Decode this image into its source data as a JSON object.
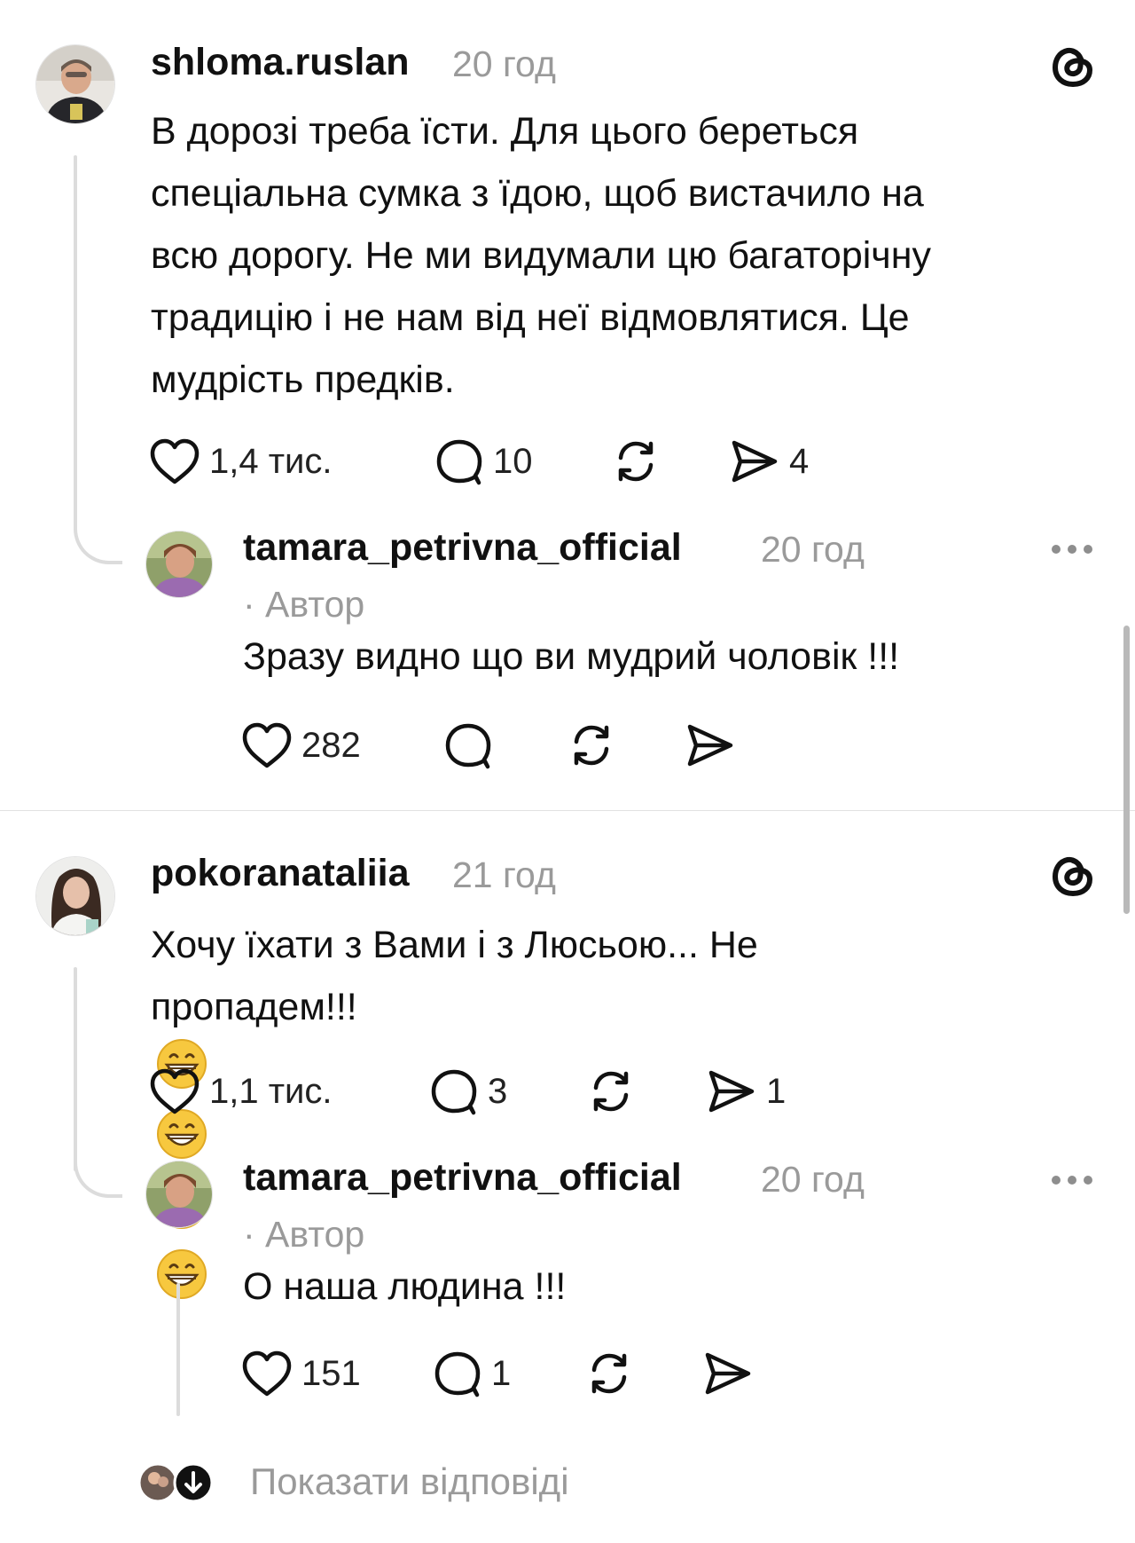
{
  "posts": [
    {
      "username": "shloma.ruslan",
      "time": "20 год",
      "text_lines": [
        "В дорозі треба їсти. Для цього береться",
        "спеціальна сумка з їдою, щоб вистачило на",
        "всю дорогу. Не ми видумали цю багаторічну",
        "традицію і не нам від неї відмовлятися. Це",
        "мудрість предків."
      ],
      "likes": "1,4 тис.",
      "comments": "10",
      "shares": "4",
      "reply": {
        "username": "tamara_petrivna_official",
        "time": "20 год",
        "author_label": "· Автор",
        "text": "Зразу видно що ви мудрий чоловік !!!",
        "likes": "282"
      }
    },
    {
      "username": "pokoranataliia",
      "time": "21 год",
      "text_line1": "Хочу їхати з Вами і з Люсьою... Не",
      "text_line2": "пропадем!!!",
      "emoji": "grinning-face-with-smiling-eyes x4",
      "likes": "1,1 тис.",
      "comments": "3",
      "shares": "1",
      "reply": {
        "username": "tamara_petrivna_official",
        "time": "20 год",
        "author_label": "· Автор",
        "text": "О наша людина !!!",
        "likes": "151",
        "comments": "1"
      }
    }
  ],
  "show_replies_label": "Показати відповіді",
  "colors": {
    "text": "#111111",
    "muted": "#9a9a9a",
    "divider": "#e2e2e2",
    "thread_line": "#dcdcdc"
  },
  "icons": [
    "threads-logo-icon",
    "heart-icon",
    "comment-icon",
    "repost-icon",
    "share-icon",
    "more-icon",
    "avatar"
  ]
}
